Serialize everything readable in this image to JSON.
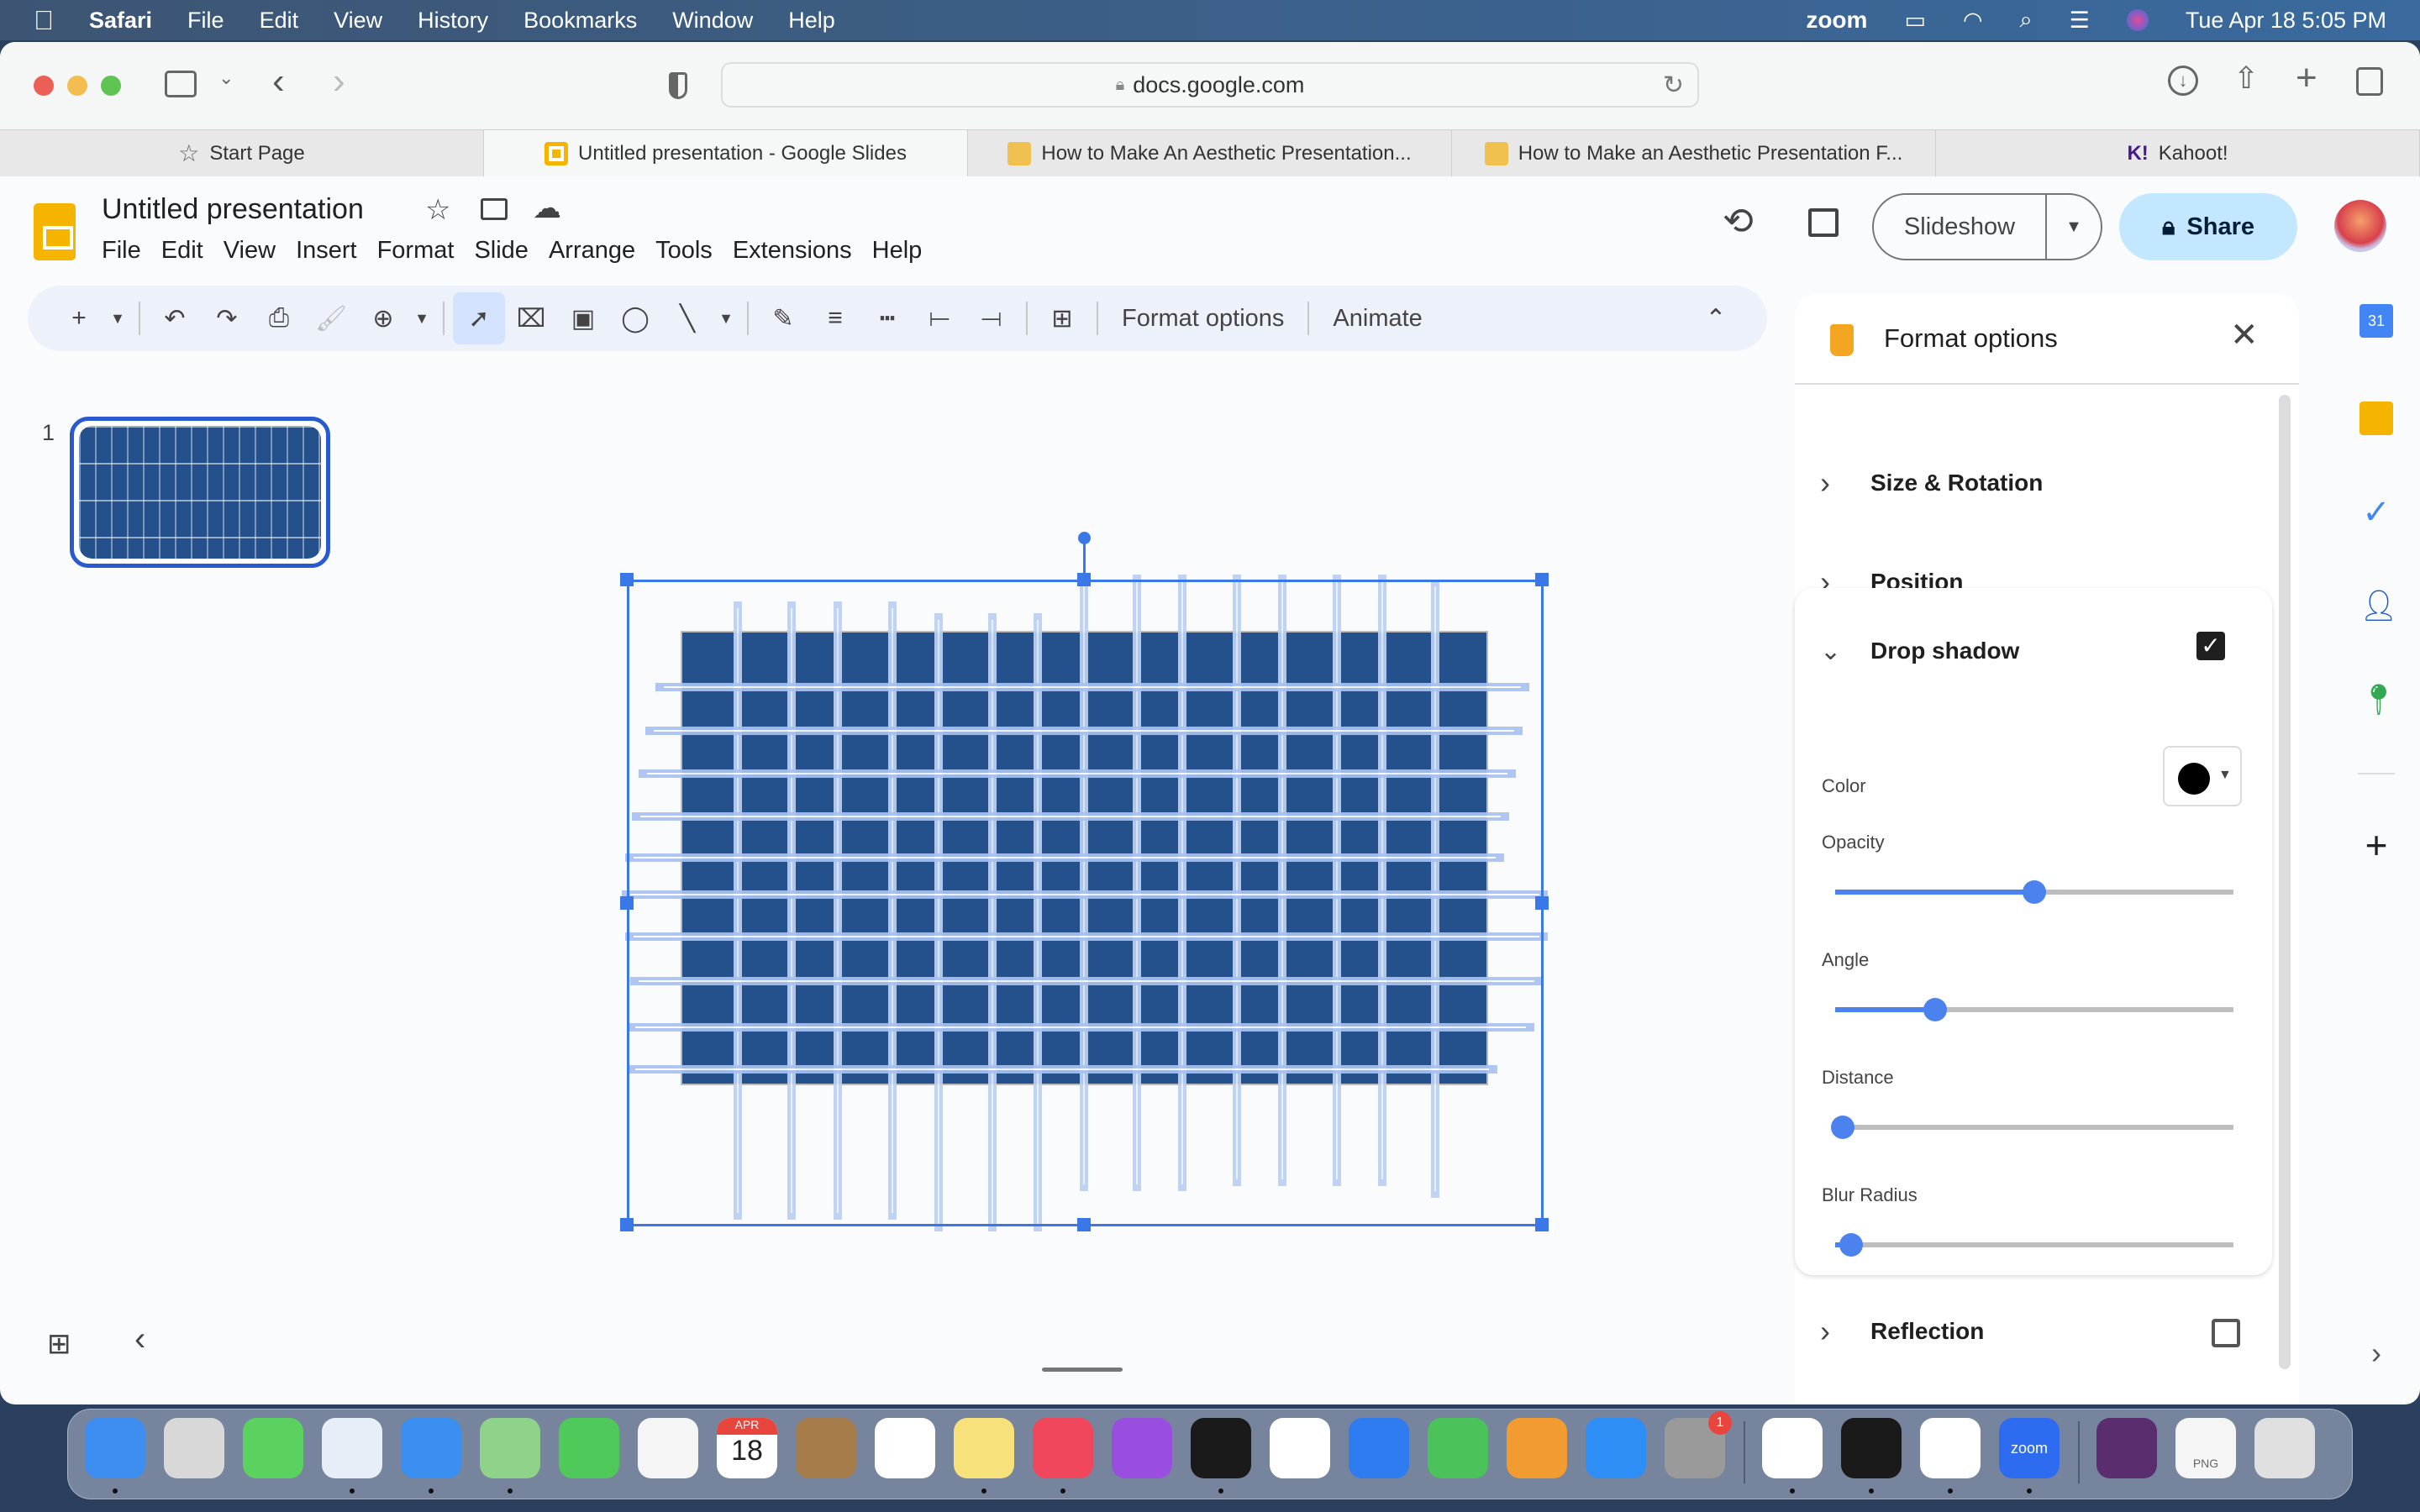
{
  "menubar": {
    "app": "Safari",
    "items": [
      "File",
      "Edit",
      "View",
      "History",
      "Bookmarks",
      "Window",
      "Help"
    ],
    "status": {
      "zoom_label": "zoom",
      "datetime": "Tue Apr 18  5:05 PM"
    }
  },
  "browser": {
    "url": "docs.google.com",
    "tabs": [
      {
        "label": "Start Page",
        "icon": "star-icon",
        "active": false
      },
      {
        "label": "Untitled presentation - Google Slides",
        "icon": "slides-icon",
        "active": true
      },
      {
        "label": "How to Make An Aesthetic Presentation...",
        "icon": "site-icon",
        "active": false
      },
      {
        "label": "How to Make an Aesthetic Presentation F...",
        "icon": "site-icon",
        "active": false
      },
      {
        "label": "Kahoot!",
        "icon": "kahoot-icon",
        "active": false
      }
    ]
  },
  "doc": {
    "title": "Untitled presentation",
    "menu": [
      "File",
      "Edit",
      "View",
      "Insert",
      "Format",
      "Slide",
      "Arrange",
      "Tools",
      "Extensions",
      "Help"
    ],
    "slideshow_label": "Slideshow",
    "share_label": "Share"
  },
  "toolbar": {
    "format_options_label": "Format options",
    "animate_label": "Animate"
  },
  "filmstrip": {
    "slides": [
      {
        "number": "1"
      }
    ]
  },
  "format_panel": {
    "title": "Format options",
    "sections": {
      "size_rotation": "Size & Rotation",
      "position": "Position",
      "drop_shadow": "Drop shadow",
      "reflection": "Reflection"
    },
    "drop_shadow_enabled": true,
    "reflection_enabled": false,
    "color_label": "Color",
    "color_value": "#000000",
    "sliders": [
      {
        "label": "Opacity",
        "value_pct": 50
      },
      {
        "label": "Angle",
        "value_pct": 25
      },
      {
        "label": "Distance",
        "value_pct": 2
      },
      {
        "label": "Blur Radius",
        "value_pct": 4
      }
    ]
  },
  "dock": {
    "calendar": {
      "month": "APR",
      "day": "18"
    },
    "settings_badge": "1",
    "zoom_label": "zoom",
    "file_label": "PNG"
  },
  "colors": {
    "accent": "#3b78e7",
    "shape_fill": "#24518c",
    "share_bg": "#c2e7ff"
  }
}
